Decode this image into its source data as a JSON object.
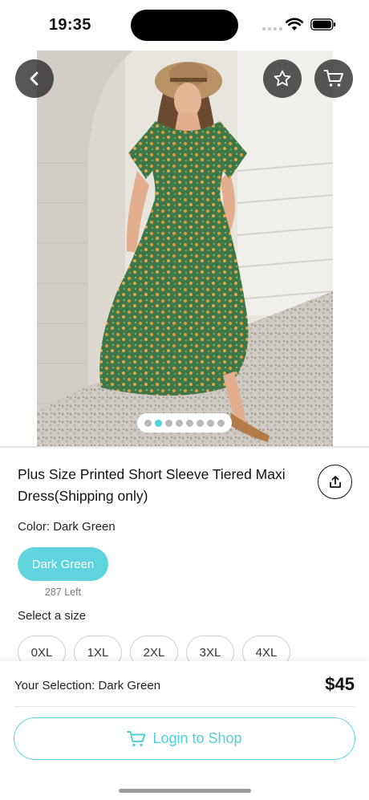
{
  "status_bar": {
    "time": "19:35"
  },
  "product": {
    "title": "Plus Size Printed Short Sleeve Tiered Maxi Dress(Shipping only)",
    "color_prefix": "Color:",
    "color_value": "Dark Green",
    "selected_color_chip": "Dark Green",
    "stock_left": "287 Left",
    "size_label": "Select a size",
    "sizes": [
      "0XL",
      "1XL",
      "2XL",
      "3XL",
      "4XL"
    ],
    "image_pages": 8,
    "active_page": 2
  },
  "bottom_bar": {
    "selection_prefix": "Your Selection:",
    "selection_value": "Dark Green",
    "price": "$45",
    "login_label": "Login to Shop"
  },
  "colors": {
    "accent": "#5fd4dc",
    "dress": "#3f7a4a",
    "overlay_button": "#2b2b2b"
  },
  "icons": [
    "back-arrow-icon",
    "star-icon",
    "cart-icon",
    "share-icon",
    "wifi-icon",
    "battery-icon"
  ]
}
